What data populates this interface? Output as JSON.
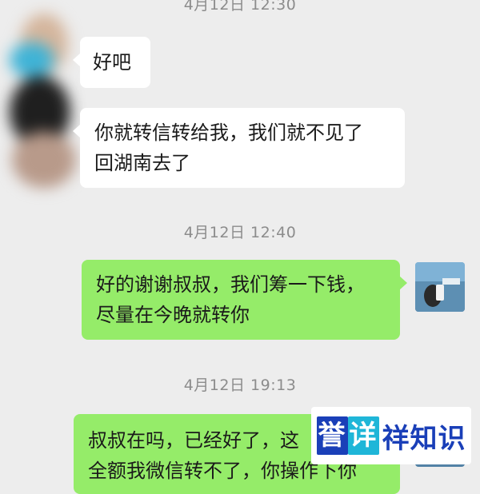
{
  "timestamps": [
    "4月12日 12:30",
    "4月12日 12:40",
    "4月12日 19:13"
  ],
  "messages": [
    {
      "side": "left",
      "text": "好吧"
    },
    {
      "side": "left",
      "lines": [
        "你就转信转给我，我们就不见了",
        "回湖南去了"
      ]
    },
    {
      "side": "right",
      "lines": [
        "好的谢谢叔叔，我们筹一下钱，",
        "尽量在今晚就转你"
      ]
    },
    {
      "side": "right",
      "lines": [
        "叔叔在吗，已经好了，这",
        "全额我微信转不了，你操作下你"
      ]
    }
  ],
  "watermark": {
    "part1": "誉",
    "part2": "详",
    "rest": "祥知识"
  },
  "colors": {
    "background": "#ededed",
    "incoming_bubble": "#ffffff",
    "outgoing_bubble": "#95ec69"
  },
  "icons": [
    "contact-avatar-blurred",
    "self-avatar"
  ]
}
